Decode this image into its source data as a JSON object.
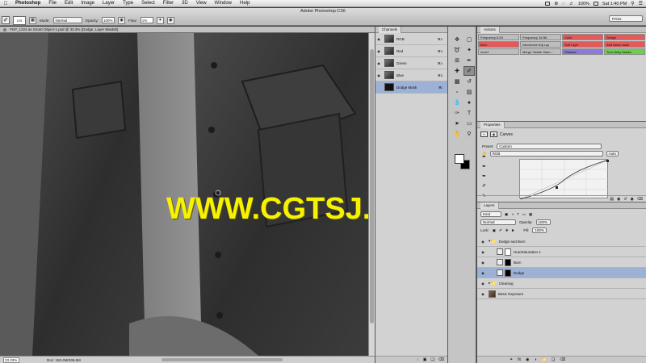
{
  "menubar": {
    "app_name": "Photoshop",
    "items": [
      "File",
      "Edit",
      "Image",
      "Layer",
      "Type",
      "Select",
      "Filter",
      "3D",
      "View",
      "Window",
      "Help"
    ],
    "battery": "100%",
    "clock": "Sat 1:40 PM"
  },
  "options": {
    "window_title": "Adobe Photoshop CS6",
    "brush_size": "125",
    "mode_label": "Mode:",
    "mode_value": "Normal",
    "opacity_label": "Opacity:",
    "opacity_value": "100%",
    "flow_label": "Flow:",
    "flow_value": "1%",
    "workspace": "Prints"
  },
  "document": {
    "tab_title": "FKP_1224 as Smart Object-1.psd @ 33.3% (Dodge, Layer Mask/8)",
    "zoom": "33.33%",
    "doc_info": "Doc: 163.4M/336.6M",
    "watermark": "WWW.CGTSJ.COM"
  },
  "channels": {
    "tab": "Channels",
    "rows": [
      {
        "name": "RGB",
        "key": "⌘2"
      },
      {
        "name": "Red",
        "key": "⌘3"
      },
      {
        "name": "Green",
        "key": "⌘4"
      },
      {
        "name": "Blue",
        "key": "⌘5"
      },
      {
        "name": "Dodge Mask",
        "key": "⌘\\"
      }
    ]
  },
  "actions": {
    "tab": "Actions",
    "buttons": [
      {
        "label": "Frequency 8.5V",
        "color": "#bdbdbd"
      },
      {
        "label": "Frequency 16 Bit",
        "color": "#bdbdbd"
      },
      {
        "label": "Color",
        "color": "#e35a5a"
      },
      {
        "label": "Dodge",
        "color": "#e35a5a"
      },
      {
        "label": "Burn",
        "color": "#e35a5a"
      },
      {
        "label": "Decolorize Adj Lay",
        "color": "#bdbdbd"
      },
      {
        "label": "Soft Light",
        "color": "#e35a5a"
      },
      {
        "label": "Add black mask",
        "color": "#e35a5a"
      },
      {
        "label": "Invert",
        "color": "#bdbdbd"
      },
      {
        "label": "Merge Visible Stam...",
        "color": "#bdbdbd"
      },
      {
        "label": "Shadow",
        "color": "#8f79d8"
      },
      {
        "label": "Turn Nelly Masks",
        "color": "#68d04a"
      }
    ]
  },
  "properties": {
    "tab": "Properties",
    "adjustment": "Curves",
    "preset_label": "Preset:",
    "preset_value": "Custom",
    "channel_value": "RGB",
    "auto_label": "Auto"
  },
  "layers": {
    "tab": "Layers",
    "kind": "Kind",
    "blend_mode": "Normal",
    "opacity_label": "Opacity:",
    "opacity_value": "100%",
    "lock_label": "Lock:",
    "fill_label": "Fill:",
    "fill_value": "100%",
    "rows": [
      {
        "name": "Dodge and Burn",
        "type": "group-open"
      },
      {
        "name": "Hue/Saturation 1",
        "type": "adjust"
      },
      {
        "name": "Burn",
        "type": "adjust"
      },
      {
        "name": "Dodge",
        "type": "adjust-selected"
      },
      {
        "name": "Cleaning",
        "type": "group"
      },
      {
        "name": "Basic Exposure",
        "type": "photo"
      }
    ]
  },
  "colors": {
    "selection": "#9db1d6",
    "watermark": "#f6f200"
  }
}
